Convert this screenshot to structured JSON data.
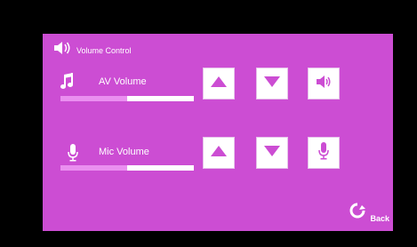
{
  "header": {
    "title": "Volume Control",
    "icon": "speaker-icon"
  },
  "rows": [
    {
      "label": "AV Volume",
      "icon": "music-note-icon",
      "level": 0.5,
      "buttons": [
        "up-arrow-icon",
        "down-arrow-icon",
        "speaker-mute-icon"
      ]
    },
    {
      "label": "Mic Volume",
      "icon": "microphone-icon",
      "level": 0.5,
      "buttons": [
        "up-arrow-icon",
        "down-arrow-icon",
        "microphone-mute-icon"
      ]
    }
  ],
  "footer": {
    "back_label": "Back",
    "back_icon": "refresh-icon"
  },
  "colors": {
    "panel": "#cc4dd3",
    "bar_fill": "#ea8ff0",
    "bar_track": "#ffffff",
    "button_icon": "#cc4dd3",
    "background": "#000000"
  }
}
